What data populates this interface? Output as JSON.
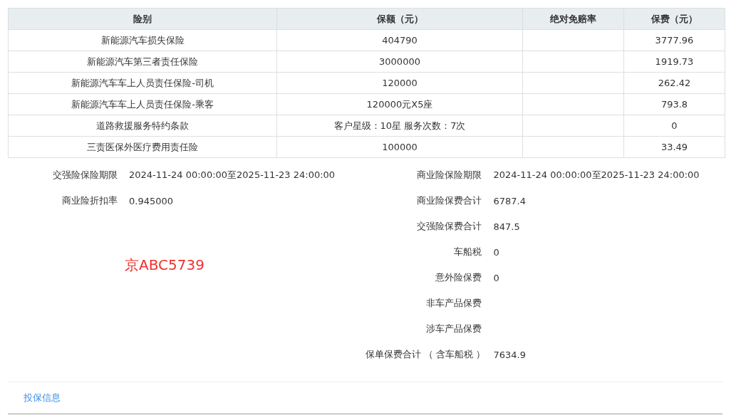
{
  "table": {
    "columns": [
      "险别",
      "保额（元）",
      "绝对免赔率",
      "保费（元）"
    ],
    "rows": [
      {
        "coverage": "新能源汽车损失保险",
        "amount": "404790",
        "premium": "3777.96"
      },
      {
        "coverage": "新能源汽车第三者责任保险",
        "amount": "3000000",
        "premium": "1919.73"
      },
      {
        "coverage": "新能源汽车车上人员责任保险-司机",
        "amount": "120000",
        "premium": "262.42"
      },
      {
        "coverage": "新能源汽车车上人员责任保险-乘客",
        "amount": "120000元X5座",
        "premium": "793.8"
      },
      {
        "coverage": "道路救援服务特约条款",
        "amount": "客户星级：10星 服务次数：7次",
        "premium": "0"
      },
      {
        "coverage": "三责医保外医疗费用责任险",
        "amount": "100000",
        "premium": "33.49"
      }
    ]
  },
  "left_fields": [
    {
      "label": "交强险保险期限",
      "value": "2024-11-24 00:00:00至2025-11-23 24:00:00"
    },
    {
      "label": "商业险折扣率",
      "value": "0.945000"
    }
  ],
  "plate_note": "京ABC5739",
  "right_fields": [
    {
      "label": "商业险保险期限",
      "value": "2024-11-24 00:00:00至2025-11-23 24:00:00"
    },
    {
      "label": "商业险保费合计",
      "value": "6787.4"
    },
    {
      "label": "交强险保费合计",
      "value": "847.5"
    },
    {
      "label": "车船税",
      "value": "0"
    },
    {
      "label": "意外险保费",
      "value": "0"
    },
    {
      "label": "非车产品保费"
    },
    {
      "label": "涉车产品保费"
    },
    {
      "label": "保单保费合计 （ 含车船税 ）",
      "value": "7634.9"
    }
  ],
  "footer_link": "投保信息"
}
